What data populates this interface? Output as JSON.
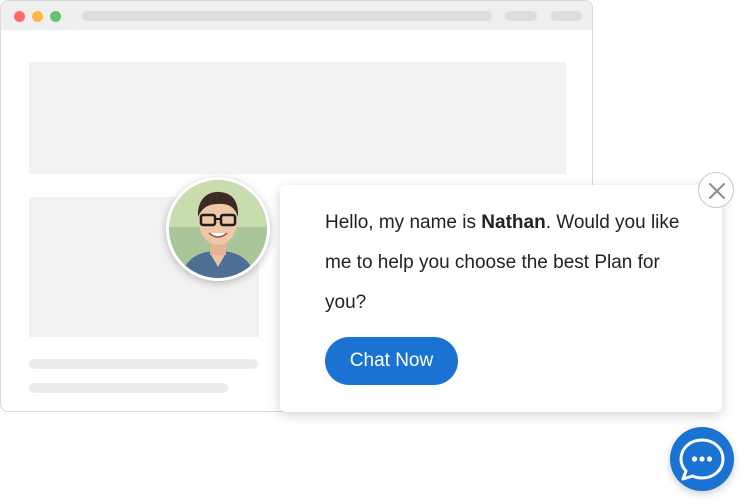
{
  "message": {
    "greeting": "Hello, my name is ",
    "agent_name": "Nathan",
    "rest": ". Would you like me to help you choose the best Plan for you?"
  },
  "chat_button": {
    "label": "Chat Now"
  },
  "icons": {
    "close": "close-icon",
    "launcher": "chat-bubble-icon",
    "avatar": "agent-avatar"
  },
  "colors": {
    "accent": "#1a73d3",
    "window_dot_red": "#ff6b6b",
    "window_dot_yellow": "#ffb74d",
    "window_dot_green": "#66c26d"
  }
}
